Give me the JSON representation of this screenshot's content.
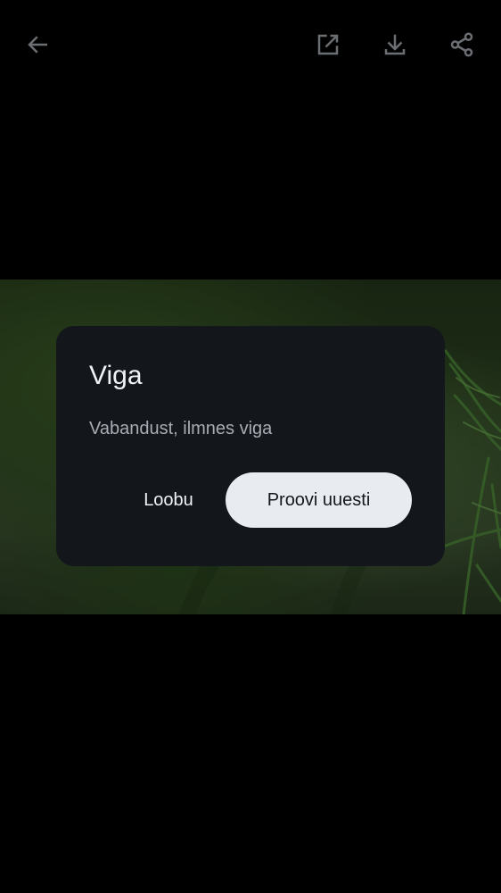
{
  "top_bar": {
    "icons": {
      "back": "arrow-back-icon",
      "open_external": "open-in-new-icon",
      "download": "download-icon",
      "share": "share-icon"
    },
    "icon_color": "#6b6e73"
  },
  "photo": {
    "description_colors": [
      "#23361a",
      "#3a5a26",
      "#4a6a3a"
    ]
  },
  "dialog": {
    "title": "Viga",
    "message": "Vabandust, ilmnes viga",
    "cancel_label": "Loobu",
    "retry_label": "Proovi uuesti",
    "background": "#13161b",
    "primary_button_color": "#e8ebf0"
  }
}
